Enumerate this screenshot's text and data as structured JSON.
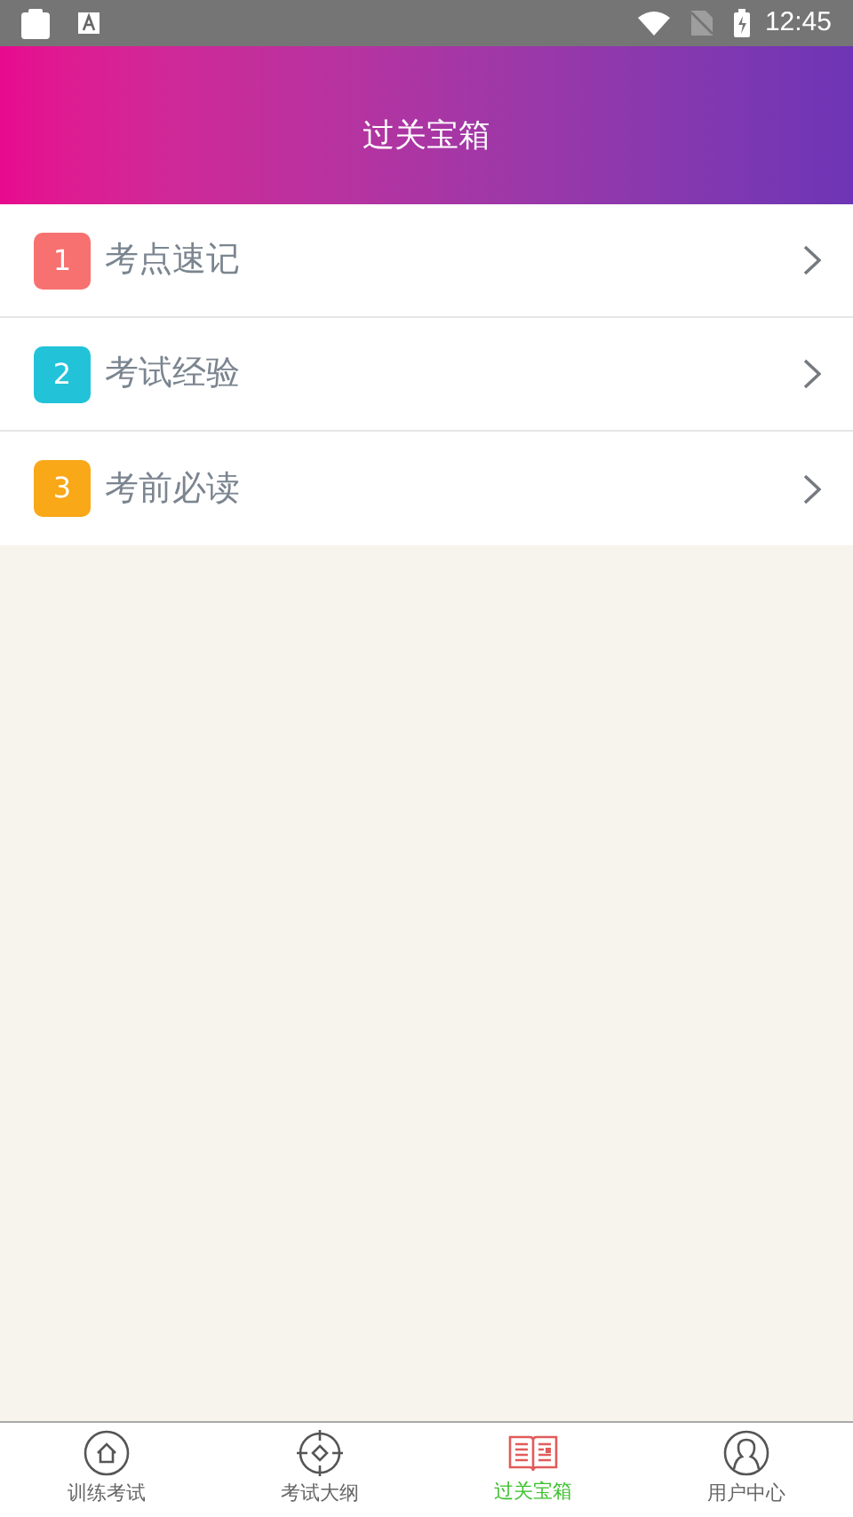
{
  "status_bar": {
    "time": "12:45"
  },
  "header": {
    "title": "过关宝箱"
  },
  "items": [
    {
      "number": "1",
      "label": "考点速记",
      "color": "#f87171"
    },
    {
      "number": "2",
      "label": "考试经验",
      "color": "#22c3d9"
    },
    {
      "number": "3",
      "label": "考前必读",
      "color": "#f9a818"
    }
  ],
  "tabs": [
    {
      "kind": "home",
      "label": "训练考试",
      "selected": false
    },
    {
      "kind": "target",
      "label": "考试大纲",
      "selected": false
    },
    {
      "kind": "book",
      "label": "过关宝箱",
      "selected": true
    },
    {
      "kind": "user",
      "label": "用户中心",
      "selected": false
    }
  ]
}
